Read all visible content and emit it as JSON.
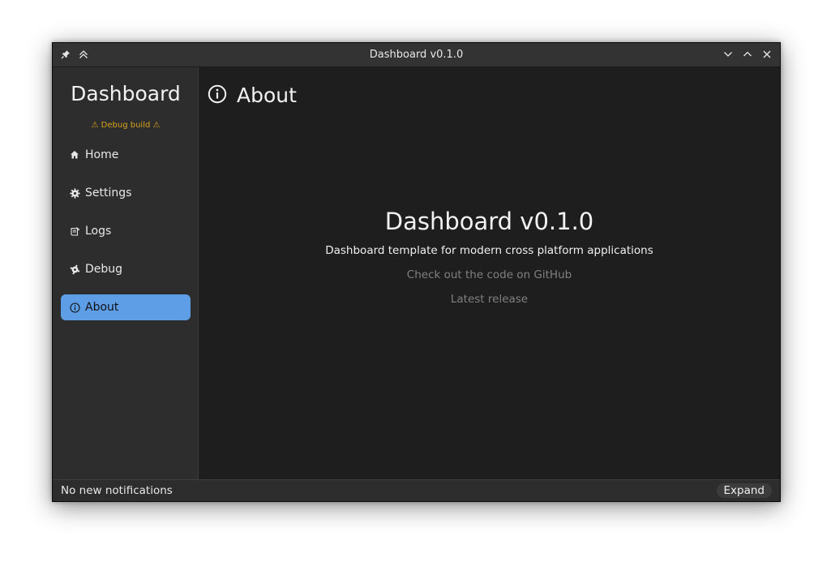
{
  "window": {
    "title": "Dashboard v0.1.0"
  },
  "titlebar_buttons": {
    "left": [
      "pin-icon",
      "keep-above-icon"
    ],
    "right": [
      "minimize-icon",
      "maximize-icon",
      "close-icon"
    ]
  },
  "sidebar": {
    "brand": "Dashboard",
    "debug_build": "⚠ Debug build ⚠",
    "items": [
      {
        "label": "Home",
        "icon": "home-icon"
      },
      {
        "label": "Settings",
        "icon": "gear-icon"
      },
      {
        "label": "Logs",
        "icon": "logs-icon"
      },
      {
        "label": "Debug",
        "icon": "bug-icon"
      },
      {
        "label": "About",
        "icon": "info-icon",
        "active": true
      }
    ]
  },
  "main": {
    "page_title": "About",
    "app_name": "Dashboard v0.1.0",
    "description": "Dashboard template for modern cross platform applications",
    "github_link": "Check out the code on GitHub",
    "release_link": "Latest release"
  },
  "statusbar": {
    "notifications": "No new notifications",
    "expand_label": "Expand"
  },
  "colors": {
    "accent": "#5e9ee6",
    "warning": "#d9a21b",
    "background": "#1e1e1e",
    "sidebar": "#2d2d2d",
    "muted_link": "#808080"
  }
}
